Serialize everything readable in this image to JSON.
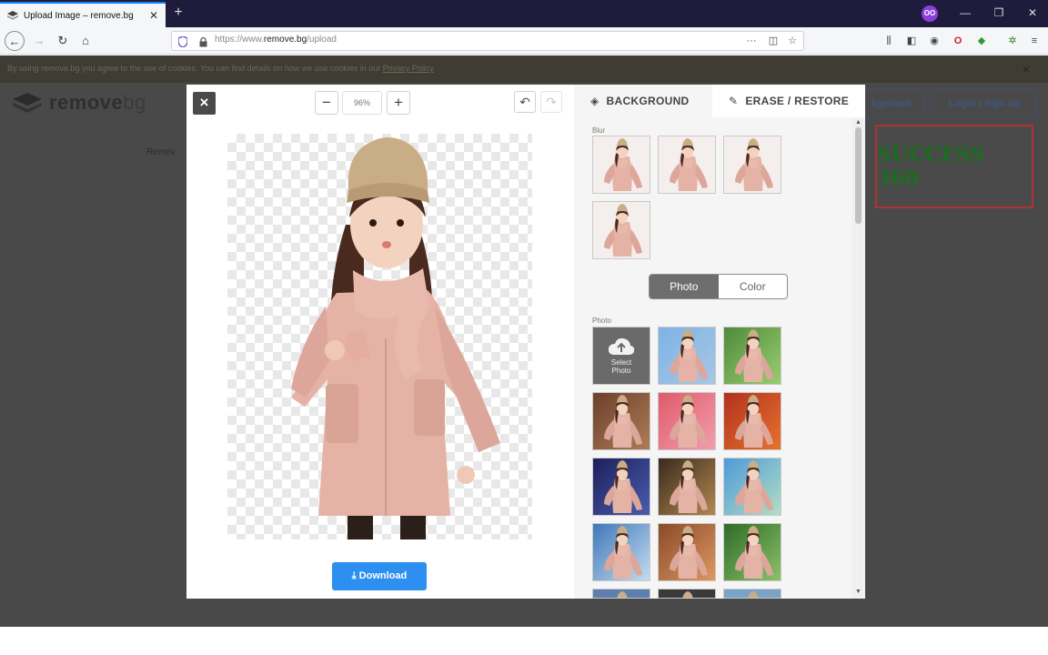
{
  "browser": {
    "tab_title": "Upload Image – remove.bg",
    "new_tab": "+",
    "profile_initials": "OO",
    "url_prefix": "https://www.",
    "url_domain": "remove.bg",
    "url_path": "/upload",
    "page_actions": "···"
  },
  "cookie_banner": {
    "text": "By using remove.bg you agree to the use of cookies. You can find details on how we use cookies in our ",
    "link": "Privacy Policy",
    "close": "×"
  },
  "site_header": {
    "logo_main": "remove",
    "logo_suffix": "bg",
    "btn_background": "kground",
    "btn_login": "Login / Sign up"
  },
  "page_content": {
    "partial_label": "Remov"
  },
  "watermark": "SUCCESS 360",
  "editor": {
    "close": "×",
    "zoom_out": "−",
    "zoom_in": "+",
    "zoom_value": "96%",
    "download_label": "Download",
    "tabs": {
      "background": "BACKGROUND",
      "erase_restore": "ERASE / RESTORE"
    },
    "blur_label": "Blur",
    "toggle": {
      "photo": "Photo",
      "color": "Color"
    },
    "photo_label": "Photo",
    "select_photo": "Select Photo"
  },
  "colors": {
    "download_blue": "#2d8fef",
    "coat_pink": "#e8b9ad",
    "hat_beige": "#c9ad86",
    "modal_overlay": "#494949"
  }
}
